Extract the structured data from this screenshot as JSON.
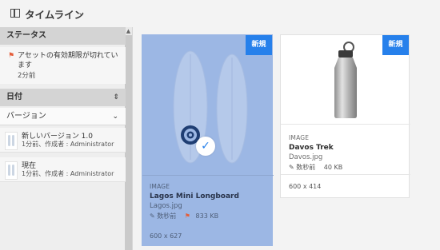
{
  "header": {
    "title": "タイムライン"
  },
  "sidebar": {
    "status_heading": "ステータス",
    "status_item": {
      "text": "アセットの有効期限が切れています",
      "time": "2分前"
    },
    "date_heading": "日付",
    "version_select": "バージョン",
    "versions": [
      {
        "title": "新しいバージョン 1.0",
        "meta": "1分前、作成者 : Administrator"
      },
      {
        "title": "現在",
        "meta": "1分前、作成者 : Administrator"
      }
    ]
  },
  "cards": [
    {
      "badge": "新規",
      "type": "IMAGE",
      "name": "Lagos Mini Longboard",
      "file": "Lagos.jpg",
      "modified": "数秒前",
      "size": "833 KB",
      "dims": "600 x 627",
      "selected": true
    },
    {
      "badge": "新規",
      "type": "IMAGE",
      "name": "Davos Trek",
      "file": "Davos.jpg",
      "modified": "数秒前",
      "size": "40 KB",
      "dims": "600 x 414",
      "selected": false
    }
  ],
  "colors": {
    "accent": "#2680eb",
    "selection": "#9cb7e4",
    "status_flag": "#e45e3a"
  }
}
